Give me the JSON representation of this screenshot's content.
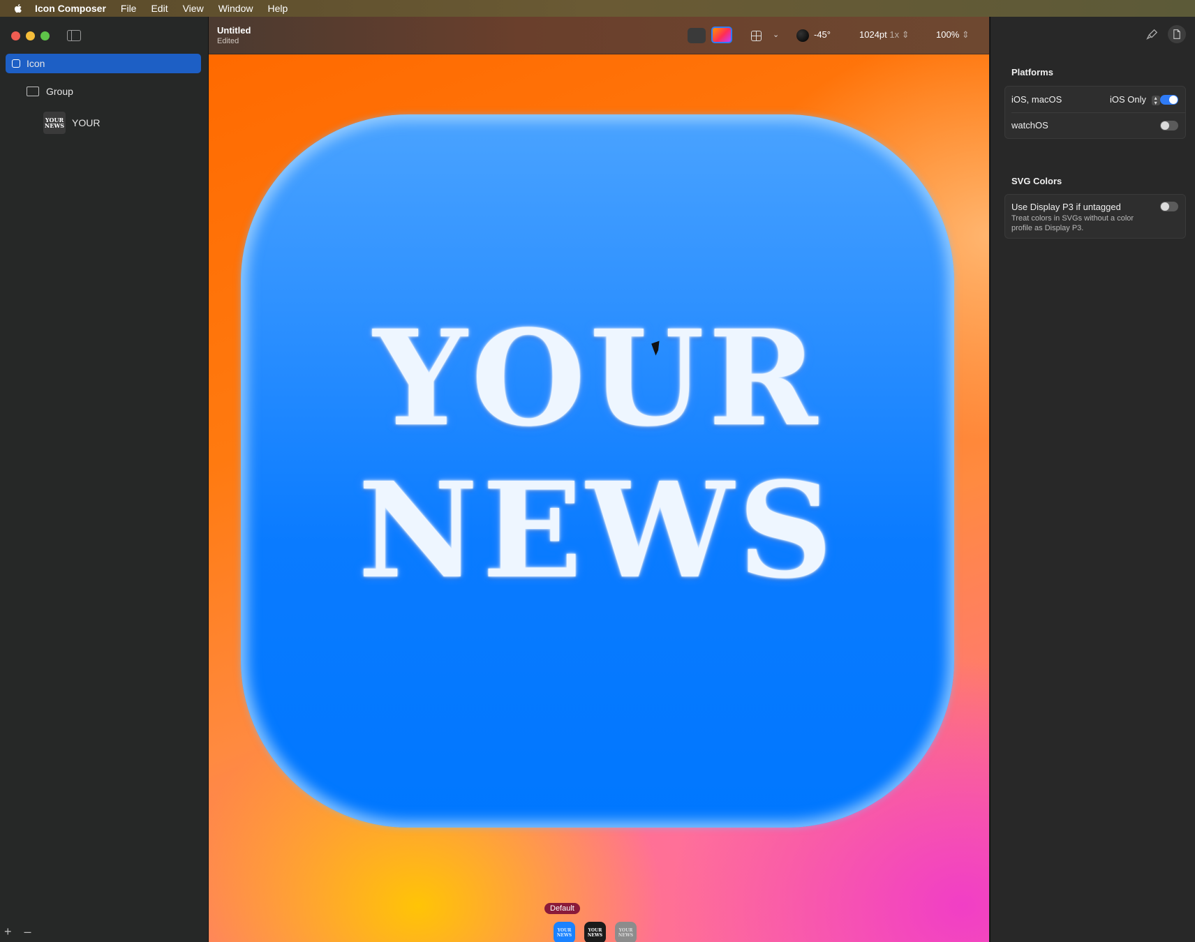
{
  "menubar": {
    "app_name": "Icon Composer",
    "items": [
      "File",
      "Edit",
      "View",
      "Window",
      "Help"
    ]
  },
  "sidebar": {
    "tree": {
      "root": "Icon",
      "group": "Group",
      "layer": "YOUR"
    },
    "thumb_text": [
      "YOUR",
      "NEWS"
    ],
    "bottom": {
      "add": "+",
      "remove": "–"
    }
  },
  "toolbar": {
    "doc_title": "Untitled",
    "doc_status": "Edited",
    "light_angle": "-45°",
    "size": "1024pt",
    "scale": "1x",
    "zoom": "100%"
  },
  "canvas": {
    "icon_text_line1": "YOUR",
    "icon_text_line2": "NEWS",
    "appearance_label": "Default",
    "variants": [
      {
        "name": "default",
        "line1": "YOUR",
        "line2": "NEWS"
      },
      {
        "name": "dark",
        "line1": "YOUR",
        "line2": "NEWS"
      },
      {
        "name": "tinted",
        "line1": "YOUR",
        "line2": "NEWS"
      }
    ],
    "icon_color": "#0a7bff"
  },
  "inspector": {
    "platforms_title": "Platforms",
    "ios_macos_label": "iOS, macOS",
    "ios_mode": "iOS Only",
    "ios_macos_enabled": true,
    "watchos_label": "watchOS",
    "watchos_enabled": false,
    "svg_title": "SVG Colors",
    "display_p3_label": "Use Display P3 if untagged",
    "display_p3_desc": "Treat colors in SVGs without a color profile as Display P3.",
    "display_p3_enabled": false
  },
  "colors": {
    "accent": "#2f7bf6",
    "selection": "#1d5fc5"
  }
}
